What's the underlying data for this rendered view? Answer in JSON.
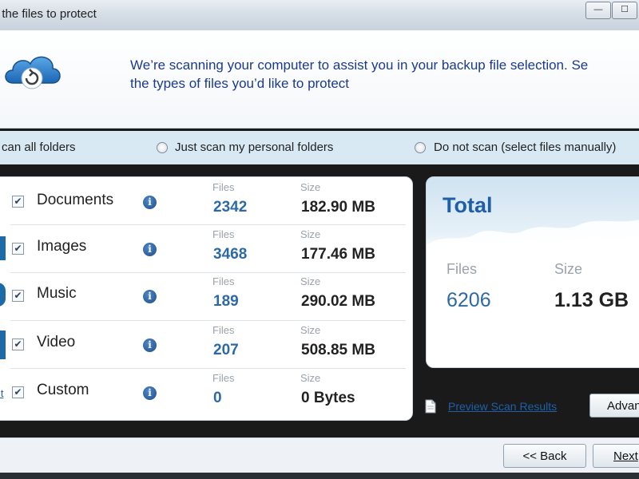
{
  "window": {
    "title": "t the files to protect",
    "minimize_glyph": "—",
    "maximize_glyph": "☐"
  },
  "header": {
    "intro_line1": "We’re scanning your computer to assist you in your backup file selection. Se",
    "intro_line2": "the types of files you’d like to protect"
  },
  "scan_options": [
    {
      "label": "can all folders",
      "selected": true
    },
    {
      "label": "Just scan my personal folders",
      "selected": false
    },
    {
      "label": "Do not scan (select files manually)",
      "selected": false
    }
  ],
  "columns": {
    "files": "Files",
    "size": "Size"
  },
  "categories": [
    {
      "name": "Documents",
      "checked": true,
      "files": "2342",
      "size": "182.90 MB"
    },
    {
      "name": "Images",
      "checked": true,
      "files": "3468",
      "size": "177.46 MB"
    },
    {
      "name": "Music",
      "checked": true,
      "files": "189",
      "size": "290.02 MB"
    },
    {
      "name": "Video",
      "checked": true,
      "files": "207",
      "size": "508.85 MB"
    },
    {
      "name": "Custom",
      "checked": true,
      "files": "0",
      "size": "0 Bytes"
    }
  ],
  "custom_edit_link": "it",
  "info_glyph": "i",
  "check_glyph": "✔",
  "total": {
    "title": "Total",
    "files_label": "Files",
    "size_label": "Size",
    "files": "6206",
    "size": "1.13 GB"
  },
  "links": {
    "preview": "Preview Scan Results"
  },
  "buttons": {
    "advanced": "Advan",
    "back": "<< Back",
    "next": "Next"
  },
  "colors": {
    "accent_blue": "#2d6aa5",
    "title_blue": "#1f5fa8",
    "intro_blue": "#1b3a8c",
    "scanbar_bg": "#d9e9f3"
  }
}
